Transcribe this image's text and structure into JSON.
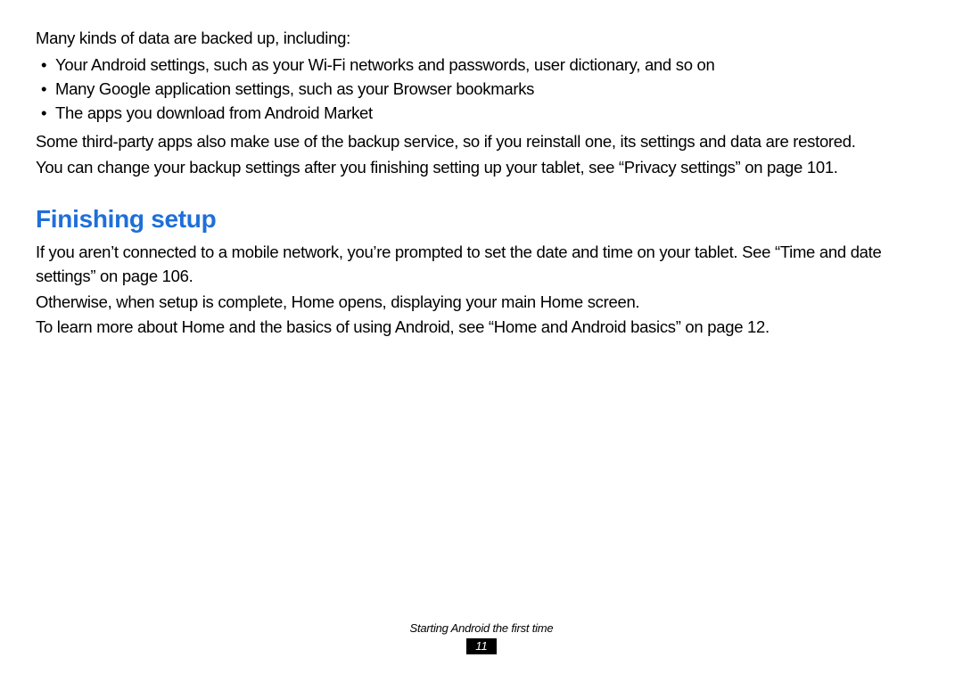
{
  "section1": {
    "intro": "Many kinds of data are backed up, including:",
    "bullets": [
      "Your Android settings, such as your Wi-Fi networks and passwords, user dictionary, and so on",
      "Many Google application settings, such as your Browser bookmarks",
      "The apps you download from Android Market"
    ],
    "para1": "Some third-party apps also make use of the backup service, so if you reinstall one, its settings and data are restored.",
    "para2": "You can change your backup settings after you finishing setting up your tablet, see “Privacy settings” on page 101."
  },
  "section2": {
    "heading": "Finishing setup",
    "para1": "If you aren’t connected to a mobile network, you’re prompted to set the date and time on your tablet. See “Time and date settings” on page 106.",
    "para2": "Otherwise, when setup is complete, Home opens, displaying your main Home screen.",
    "para3": "To learn more about Home and the basics of using Android, see “Home and Android basics” on page 12."
  },
  "footer": {
    "chapterTitle": "Starting Android the first time",
    "pageNumber": "11"
  }
}
